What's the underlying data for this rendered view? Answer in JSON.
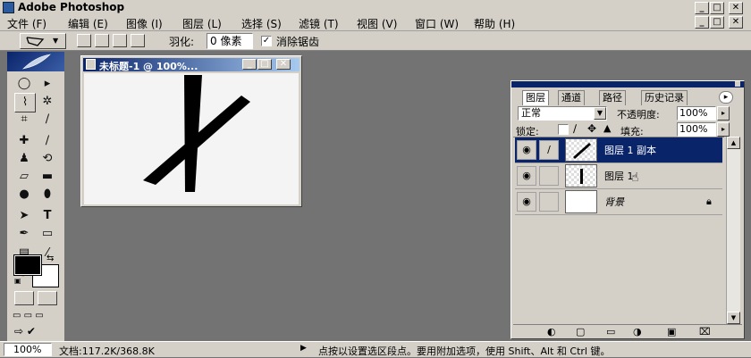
{
  "app": {
    "title": "Adobe Photoshop"
  },
  "menu": [
    "文件 (F)",
    "编辑 (E)",
    "图像 (I)",
    "图层 (L)",
    "选择 (S)",
    "滤镜 (T)",
    "视图 (V)",
    "窗口 (W)",
    "帮助 (H)"
  ],
  "options": {
    "feather_label": "羽化:",
    "feather_value": "0 像素",
    "antialias_label": "消除锯齿",
    "antialias_checked": true
  },
  "document": {
    "title": "未标题-1 @ 100%..."
  },
  "layers_panel": {
    "tabs": [
      "图层",
      "通道",
      "路径",
      "历史记录"
    ],
    "blend_mode": "正常",
    "opacity_label": "不透明度:",
    "opacity_value": "100%",
    "lock_label": "锁定:",
    "fill_label": "填充:",
    "fill_value": "100%",
    "layers": [
      {
        "name": "图层 1 副本",
        "selected": true
      },
      {
        "name": "图层 1",
        "selected": false
      },
      {
        "name": "背景",
        "selected": false
      }
    ]
  },
  "status": {
    "zoom": "100%",
    "doc_info": "文档:117.2K/368.8K",
    "message": "点按以设置选区段点。要用附加选项，使用 Shift、Alt 和 Ctrl 键。"
  },
  "colors": {
    "selection": "#0a246a",
    "workspace": "#737373",
    "chrome": "#d4d0c8"
  }
}
